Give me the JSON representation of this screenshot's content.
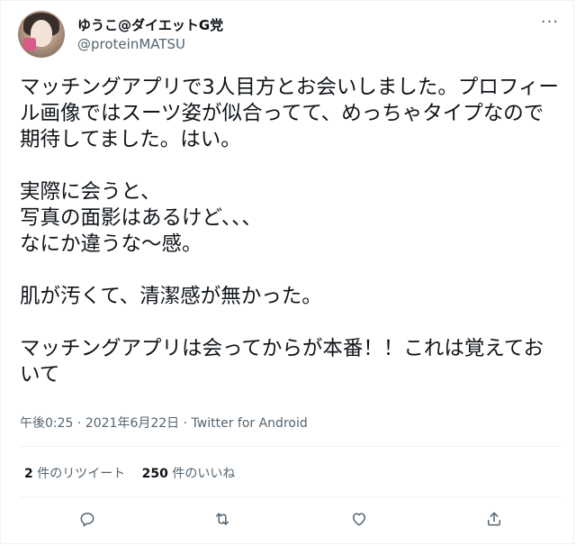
{
  "user": {
    "display_name": "ゆうこ@ダイエットG党",
    "handle": "@proteinMATSU",
    "avatar": "profile-photo"
  },
  "more_icon": "more-options-icon",
  "tweet": {
    "paragraphs": [
      "マッチングアプリで3人目方とお会いしました。プロフィール画像ではスーツ姿が似合ってて、めっちゃタイプなので期待してました。はい。",
      "実際に会うと、\n写真の面影はあるけど、、、\nなにか違うな〜感。",
      "肌が汚くて、清潔感が無かった。",
      "マッチングアプリは会ってからが本番！！これは覚えておいて"
    ]
  },
  "meta": {
    "time": "午後0:25",
    "separator": " · ",
    "date": "2021年6月22日",
    "source": "Twitter for Android"
  },
  "stats": {
    "retweets_count": "2",
    "retweets_label": "件のリツイート",
    "likes_count": "250",
    "likes_label": "件のいいね"
  },
  "actions": {
    "reply": "reply-icon",
    "retweet": "retweet-icon",
    "like": "like-icon",
    "share": "share-icon"
  },
  "colors": {
    "text": "#0f1419",
    "secondary": "#536471",
    "border": "#eff3f4"
  }
}
